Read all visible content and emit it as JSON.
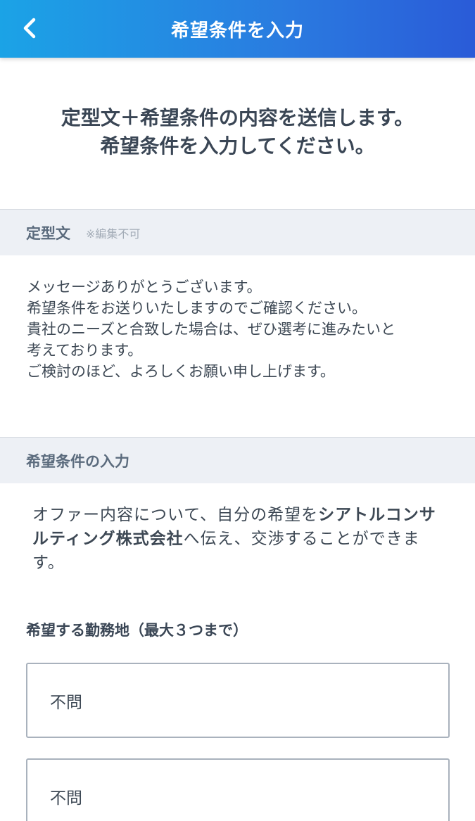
{
  "header": {
    "title": "希望条件を入力"
  },
  "intro": {
    "line1": "定型文＋希望条件の内容を送信します。",
    "line2": "希望条件を入力してください。"
  },
  "template_section": {
    "title": "定型文",
    "note": "※編集不可",
    "lines": [
      "メッセージありがとうございます。",
      "希望条件をお送りいたしますのでご確認ください。",
      "貴社のニーズと合致した場合は、ぜひ選考に進みたいと",
      "考えております。",
      "ご検討のほど、よろしくお願い申し上げます。"
    ]
  },
  "conditions_section": {
    "title": "希望条件の入力",
    "description_pre": "オファー内容について、自分の希望を",
    "company_name": "シアトルコンサルティング株式会社",
    "description_post": "へ伝え、交渉することができます。"
  },
  "location_field": {
    "label": "希望する勤務地（最大３つまで）",
    "selects": [
      "不問",
      "不問"
    ]
  }
}
